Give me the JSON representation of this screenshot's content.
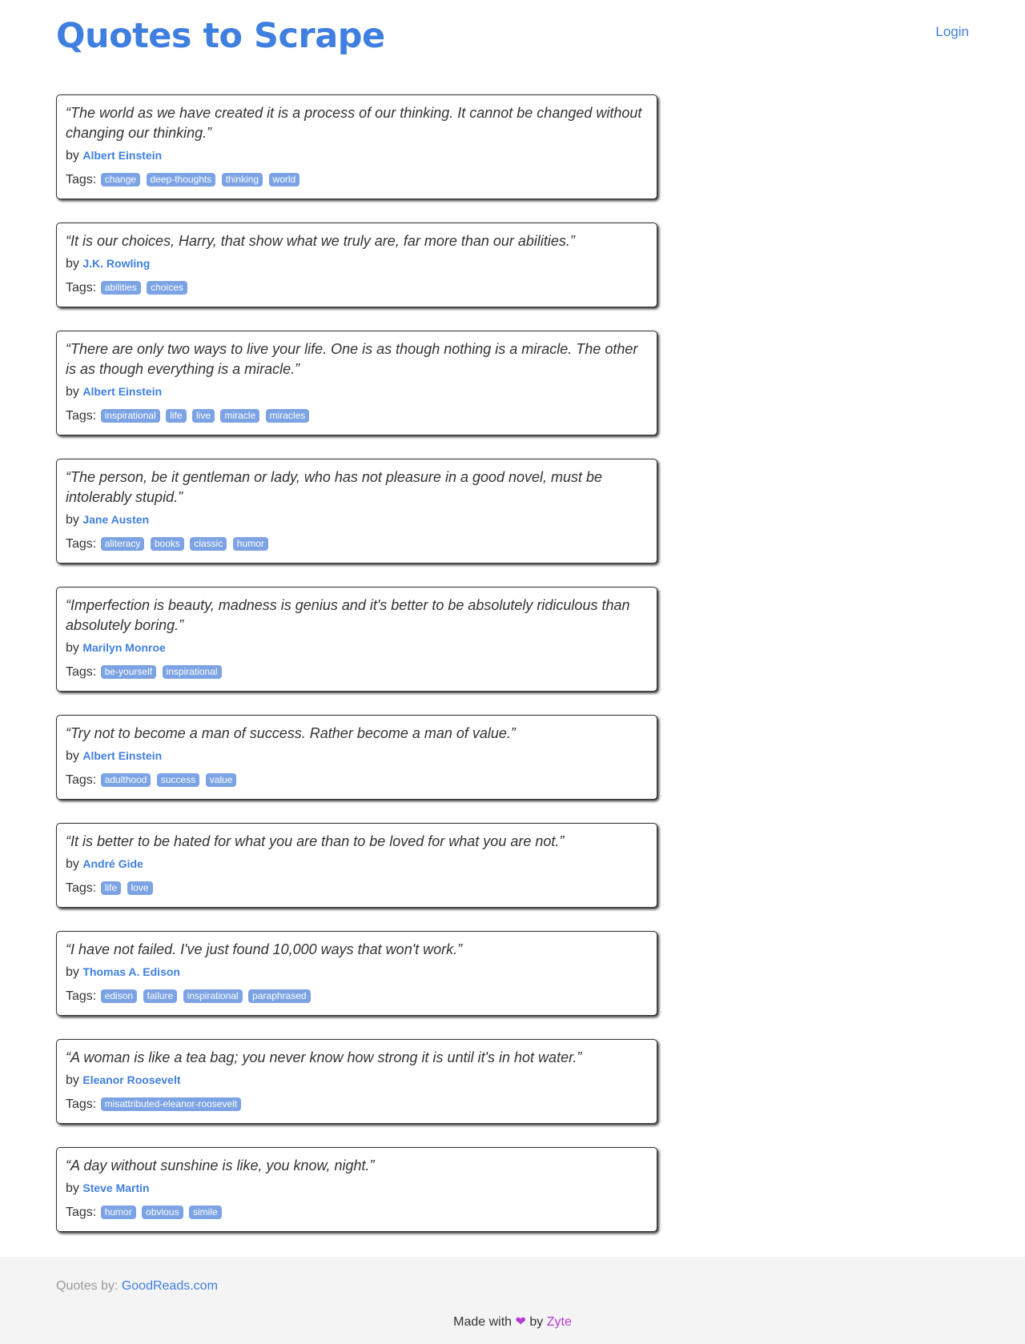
{
  "header": {
    "title": "Quotes to Scrape",
    "login_label": "Login"
  },
  "quotes": [
    {
      "text": "“The world as we have created it is a process of our thinking. It cannot be changed without changing our thinking.”",
      "by": "by",
      "author": "Albert Einstein",
      "tags_label": "Tags:",
      "tags": [
        "change",
        "deep-thoughts",
        "thinking",
        "world"
      ]
    },
    {
      "text": "“It is our choices, Harry, that show what we truly are, far more than our abilities.”",
      "by": "by",
      "author": "J.K. Rowling",
      "tags_label": "Tags:",
      "tags": [
        "abilities",
        "choices"
      ]
    },
    {
      "text": "“There are only two ways to live your life. One is as though nothing is a miracle. The other is as though everything is a miracle.”",
      "by": "by",
      "author": "Albert Einstein",
      "tags_label": "Tags:",
      "tags": [
        "inspirational",
        "life",
        "live",
        "miracle",
        "miracles"
      ]
    },
    {
      "text": "“The person, be it gentleman or lady, who has not pleasure in a good novel, must be intolerably stupid.”",
      "by": "by",
      "author": "Jane Austen",
      "tags_label": "Tags:",
      "tags": [
        "aliteracy",
        "books",
        "classic",
        "humor"
      ]
    },
    {
      "text": "“Imperfection is beauty, madness is genius and it's better to be absolutely ridiculous than absolutely boring.”",
      "by": "by",
      "author": "Marilyn Monroe",
      "tags_label": "Tags:",
      "tags": [
        "be-yourself",
        "inspirational"
      ]
    },
    {
      "text": "“Try not to become a man of success. Rather become a man of value.”",
      "by": "by",
      "author": "Albert Einstein",
      "tags_label": "Tags:",
      "tags": [
        "adulthood",
        "success",
        "value"
      ]
    },
    {
      "text": "“It is better to be hated for what you are than to be loved for what you are not.”",
      "by": "by",
      "author": "André Gide",
      "tags_label": "Tags:",
      "tags": [
        "life",
        "love"
      ]
    },
    {
      "text": "“I have not failed. I've just found 10,000 ways that won't work.”",
      "by": "by",
      "author": "Thomas A. Edison",
      "tags_label": "Tags:",
      "tags": [
        "edison",
        "failure",
        "inspirational",
        "paraphrased"
      ]
    },
    {
      "text": "“A woman is like a tea bag; you never know how strong it is until it's in hot water.”",
      "by": "by",
      "author": "Eleanor Roosevelt",
      "tags_label": "Tags:",
      "tags": [
        "misattributed-eleanor-roosevelt"
      ]
    },
    {
      "text": "“A day without sunshine is like, you know, night.”",
      "by": "by",
      "author": "Steve Martin",
      "tags_label": "Tags:",
      "tags": [
        "humor",
        "obvious",
        "simile"
      ]
    }
  ],
  "footer": {
    "source_prefix": "Quotes by:",
    "source_link": "GoodReads.com",
    "made_with": "Made with",
    "heart": "❤",
    "by": "by",
    "company": "Zyte"
  },
  "colors": {
    "accent": "#3f7fe0",
    "tag_background": "#7ca3e4",
    "text": "#333333",
    "footer_background": "#f4f4f4",
    "zyte": "#b43bd6"
  }
}
